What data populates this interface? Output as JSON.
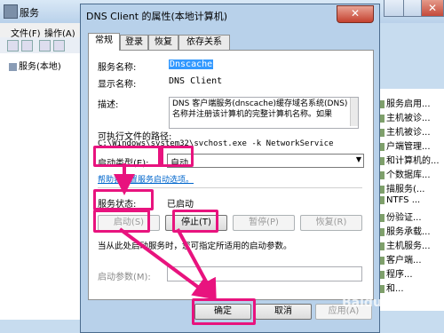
{
  "background_window": {
    "title": "服务",
    "menu": [
      "文件(F)",
      "操作(A)"
    ],
    "tree_item": "服务(本地)",
    "rows": [
      "服务启用...",
      "主机被诊...",
      "主机被诊...",
      "户端管理...",
      "和计算机的...",
      "个数据库...",
      "描服务(...",
      "NTFS ...",
      "份验证...",
      "服务承载...",
      "主机服务...",
      "客户端...",
      "程序...",
      "和..."
    ]
  },
  "dialog": {
    "title": "DNS Client 的属性(本地计算机)",
    "close_glyph": "✕",
    "tabs": [
      "常规",
      "登录",
      "恢复",
      "依存关系"
    ],
    "service_name_label": "服务名称:",
    "service_name_value": "Dnscache",
    "display_name_label": "显示名称:",
    "display_name_value": "DNS Client",
    "description_label": "描述:",
    "description_value": "DNS 客户端服务(dnscache)缓存域名系统(DNS)名称并注册该计算机的完整计算机名称。如果",
    "exe_path_label": "可执行文件的路径:",
    "exe_path_value": "C:\\Windows\\system32\\svchost.exe -k NetworkService",
    "startup_type_label": "启动类型(E):",
    "startup_type_value": "自动",
    "help_link": "帮助我配置服务启动选项。",
    "status_label": "服务状态:",
    "status_value": "已启动",
    "buttons": {
      "start": "启动(S)",
      "stop": "停止(T)",
      "pause": "暂停(P)",
      "resume": "恢复(R)"
    },
    "hint_text": "当从此处启动服务时，您可指定所适用的启动参数。",
    "start_params_label": "启动参数(M):",
    "ok": "确定",
    "cancel": "取消",
    "apply": "应用(A)"
  },
  "watermark": "Baidu 经验",
  "colors": {
    "highlight": "#e8137e",
    "selection": "#3399ff",
    "link": "#0066cc"
  }
}
